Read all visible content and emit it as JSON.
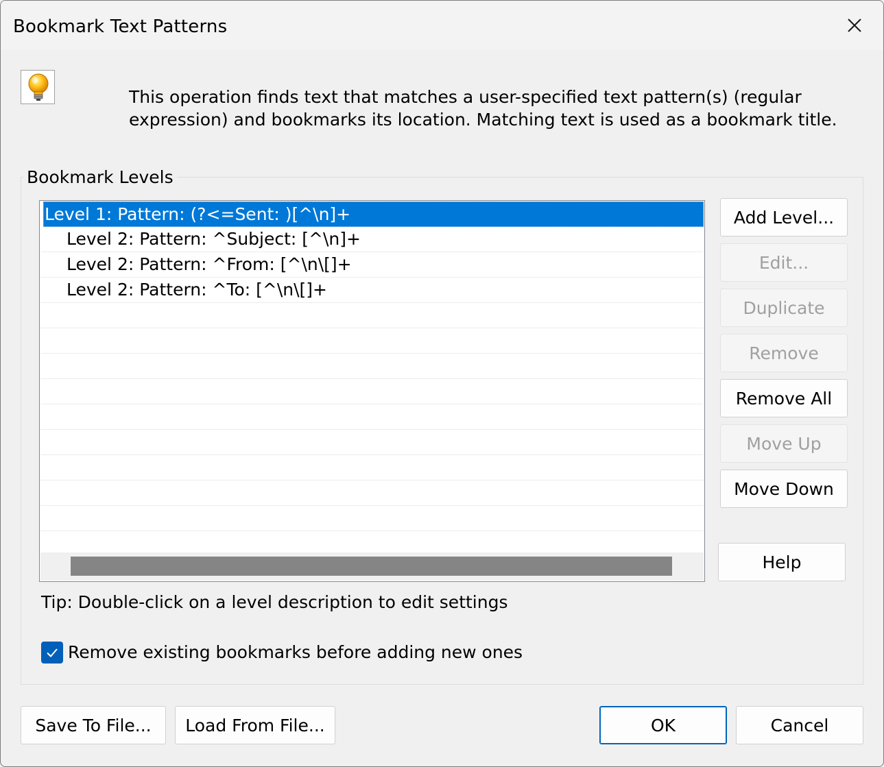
{
  "window": {
    "title": "Bookmark Text Patterns"
  },
  "info": {
    "icon": "lightbulb-icon",
    "line1": "This operation finds text that matches a user-specified text pattern(s) (regular",
    "line2": "expression) and bookmarks its location. Matching text is used as a bookmark title."
  },
  "levels_group": {
    "label": "Bookmark Levels",
    "items": [
      {
        "text": "Level 1: Pattern: (?<=Sent: )[^\\n]+",
        "selected": true
      },
      {
        "text": "Level 2: Pattern: ^Subject: [^\\n]+",
        "selected": false
      },
      {
        "text": "Level 2: Pattern: ^From: [^\\n\\[]+",
        "selected": false
      },
      {
        "text": "Level 2: Pattern: ^To: [^\\n\\[]+",
        "selected": false
      }
    ]
  },
  "side_buttons": {
    "add_level": "Add Level...",
    "edit": "Edit...",
    "duplicate": "Duplicate",
    "remove": "Remove",
    "remove_all": "Remove All",
    "move_up": "Move Up",
    "move_down": "Move Down",
    "help": "Help"
  },
  "tip": "Tip: Double-click on a level description to edit settings",
  "remove_existing": {
    "label": "Remove existing bookmarks before adding new ones",
    "checked": true
  },
  "footer": {
    "save_to_file": "Save To File...",
    "load_from_file": "Load From File...",
    "ok": "OK",
    "cancel": "Cancel"
  },
  "colors": {
    "selection": "#0078d7",
    "checkbox": "#005fb8"
  }
}
